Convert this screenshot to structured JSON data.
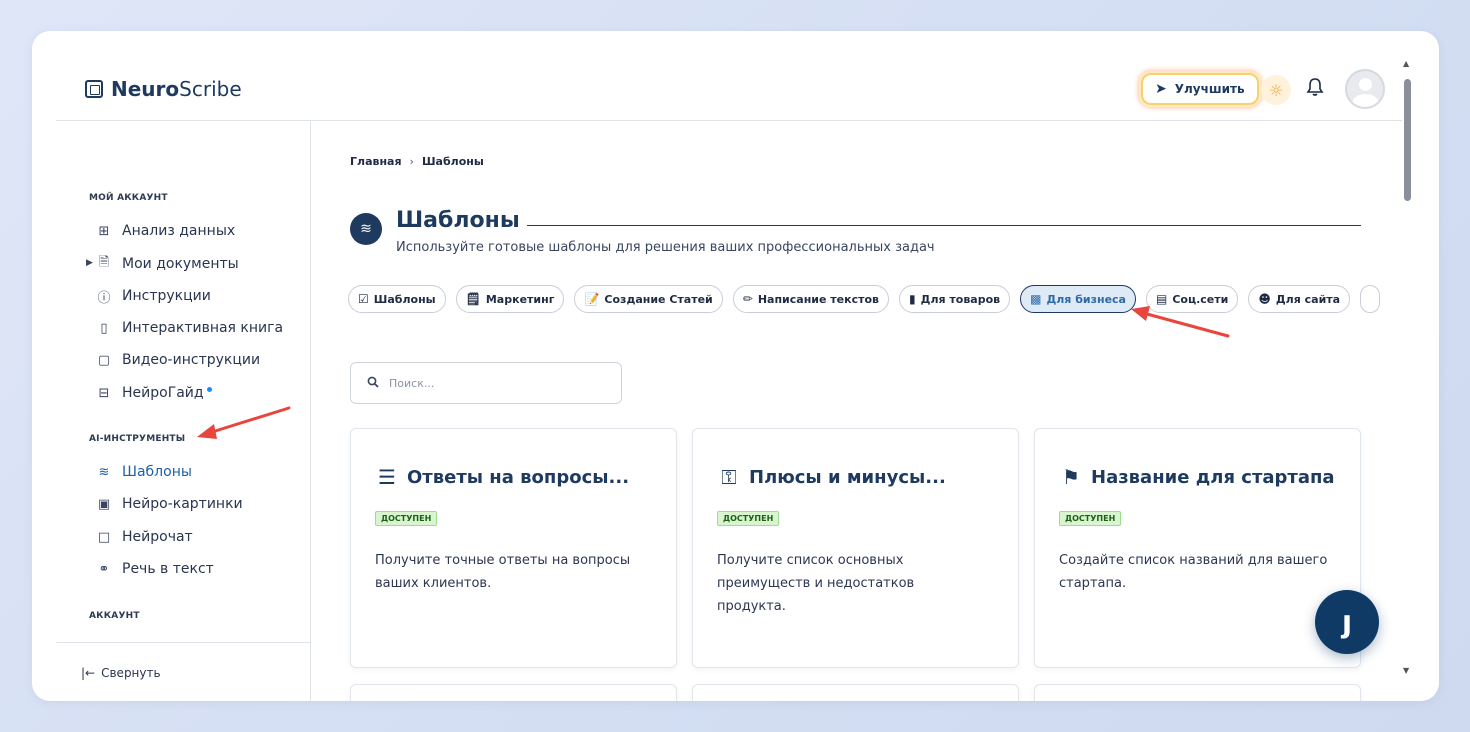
{
  "header": {
    "logo_bold": "Neuro",
    "logo_light": "Scribe",
    "upgrade_label": "Улучшить"
  },
  "sidebar": {
    "section_account": "МОЙ АККАУНТ",
    "account_items": [
      {
        "label": "Анализ данных",
        "icon": "grid-icon"
      },
      {
        "label": "Мои документы",
        "icon": "document-icon"
      },
      {
        "label": "Инструкции",
        "icon": "help-circle-icon"
      },
      {
        "label": "Интерактивная книга",
        "icon": "book-icon"
      },
      {
        "label": "Видео-инструкции",
        "icon": "video-icon"
      },
      {
        "label": "НейроГайд",
        "icon": "layout-icon"
      }
    ],
    "section_ai": "AI-ИНСТРУМЕНТЫ",
    "ai_items": [
      {
        "label": "Шаблоны",
        "icon": "layers-icon",
        "active": true
      },
      {
        "label": "Нейро-картинки",
        "icon": "image-icon"
      },
      {
        "label": "Нейрочат",
        "icon": "chat-icon"
      },
      {
        "label": "Речь в текст",
        "icon": "headphones-icon"
      }
    ],
    "section_acc2": "АККАУНТ",
    "collapse_label": "Свернуть"
  },
  "main": {
    "breadcrumb": [
      "Главная",
      "Шаблоны"
    ],
    "title": "Шаблоны",
    "subtitle": "Используйте готовые шаблоны для решения ваших профессиональных задач",
    "pills": [
      {
        "label": "Шаблоны",
        "icon": "checkbox-icon"
      },
      {
        "label": "Маркетинг",
        "icon": "notepad-icon"
      },
      {
        "label": "Создание Статей",
        "icon": "memo-icon"
      },
      {
        "label": "Написание текстов",
        "icon": "pen-icon"
      },
      {
        "label": "Для товаров",
        "icon": "phone-icon"
      },
      {
        "label": "Для бизнеса",
        "icon": "laptop-icon",
        "active": true
      },
      {
        "label": "Соц.сети",
        "icon": "ledger-icon"
      },
      {
        "label": "Для сайта",
        "icon": "mask-icon"
      }
    ],
    "search_placeholder": "Поиск...",
    "cards": [
      {
        "title": "Ответы на вопросы...",
        "badge": "ДОСТУПЕН",
        "desc": "Получите точные ответы на вопросы ваших клиентов.",
        "icon": "list-icon"
      },
      {
        "title": "Плюсы и минусы...",
        "badge": "ДОСТУПЕН",
        "desc": "Получите список основных преимуществ и недостатков продукта.",
        "icon": "key-icon"
      },
      {
        "title": "Название для стартапа",
        "badge": "ДОСТУПЕН",
        "desc": "Создайте список названий для вашего стартапа.",
        "icon": "megaphone-icon"
      }
    ]
  },
  "colors": {
    "brand": "#1e3a5f",
    "active_text": "#1f5fa8",
    "badge_bg": "#d9f5d0",
    "arrow": "#e8453c"
  }
}
